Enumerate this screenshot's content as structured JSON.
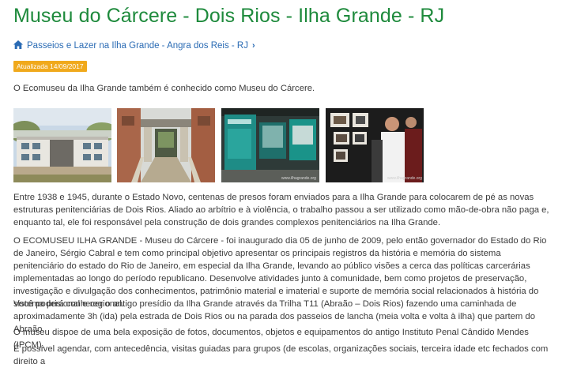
{
  "article": {
    "title": "Museu do Cárcere - Dois Rios - Ilha Grande - RJ",
    "breadcrumb": "Passeios e Lazer na Ilha Grande - Angra dos Reis - RJ",
    "updated_badge": "Atualizada 14/09/2017",
    "intro": "O Ecomuseu da Ilha Grande também é conhecido como Museu do Cárcere.",
    "gallery": [
      {
        "icon": "photo-prison-building"
      },
      {
        "icon": "photo-prison-courtyard"
      },
      {
        "icon": "photo-museum-exhibit",
        "watermark": "www.ilhagrande.org"
      },
      {
        "icon": "photo-museum-visitors",
        "watermark": "www.ilhagrande.org"
      }
    ],
    "paragraphs": [
      "Entre 1938 e 1945, durante o Estado Novo, centenas de presos foram enviados para a Ilha Grande para colocarem de pé as novas estruturas penitenciárias de Dois Rios. Aliado ao arbítrio e à violência, o trabalho passou a ser utilizado como mão-de-obra não paga e, enquanto tal, ele foi responsável pela construção de dois grandes complexos penitenciários na Ilha Grande.",
      "O ECOMUSEU ILHA GRANDE - Museu do Cárcere - foi inaugurado dia 05 de junho de 2009, pelo então governador do Estado do Rio de Janeiro, Sérgio Cabral e tem como principal objetivo apresentar os principais registros da história e memória do sistema penitenciário do estado do Rio de Janeiro, em especial da Ilha Grande, levando ao público visões a cerca das políticas carcerárias implementadas ao longo do período republicano. Desenvolve atividades junto à comunidade, bem como projetos de preservação, investigação e divulgação dos conhecimentos, patrimônio material e imaterial e suporte de memória social relacionados à história do sistema prisional e regional.",
      "Você poderá conhecer o antigo presídio da Ilha Grande através da Trilha T11 (Abraão – Dois Rios) fazendo uma caminhada de aproximadamente 3h (ida) pela estrada de Dois Rios ou na parada dos passeios de lancha (meia volta e volta à ilha) que partem do Abraão.",
      "O museu dispoe de uma bela exposição de fotos, documentos, objetos e equipamentos do antigo Instituto Penal Cândido Mendes (IPCM).",
      "É possível agendar, com antecedência, visitas guiadas para grupos (de escolas, organizações sociais, terceira idade etc fechados com direito a"
    ]
  },
  "colors": {
    "title": "#1e8a3c",
    "link": "#2a6bb4",
    "badge": "#f0a91c",
    "text": "#3b3b3b"
  }
}
